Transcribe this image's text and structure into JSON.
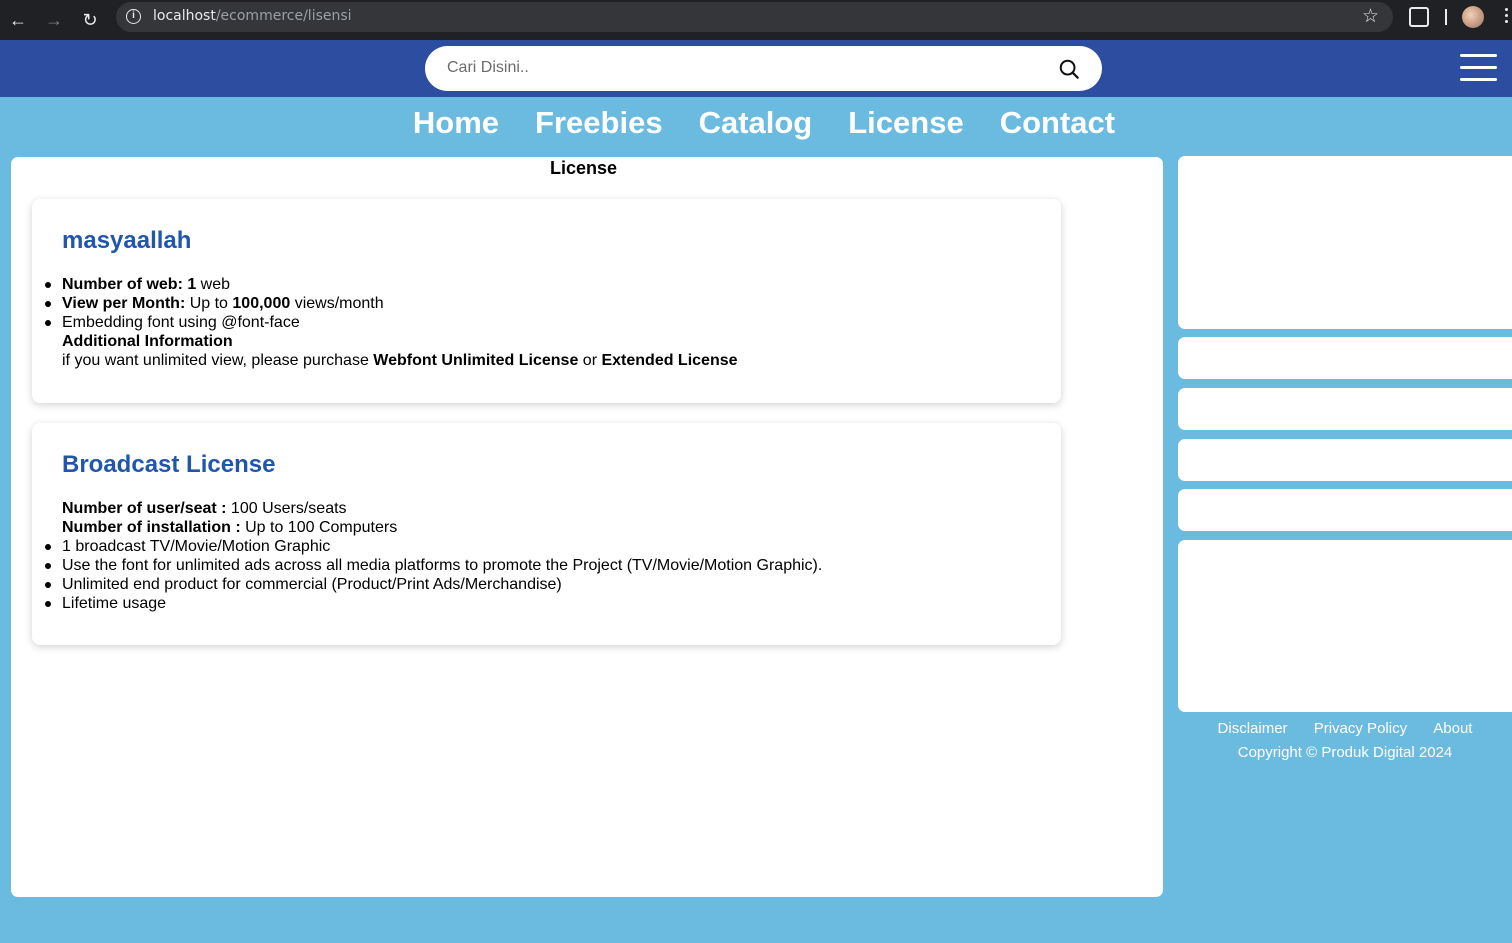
{
  "browser": {
    "url_host": "localhost",
    "url_path": "/ecommerce/lisensi"
  },
  "header": {
    "search_placeholder": "Cari Disini.."
  },
  "nav": {
    "items": [
      "Home",
      "Freebies",
      "Catalog",
      "License",
      "Contact"
    ]
  },
  "main": {
    "title": "License",
    "cards": [
      {
        "heading": "masyaallah",
        "items": [
          {
            "bold": "Number of web: 1",
            "text": " web"
          },
          {
            "bold": "View per Month:",
            "text": " Up to ",
            "bold2": "100,000",
            "text2": " views/month"
          },
          {
            "text": "Embedding font using @font-face"
          }
        ],
        "extra_title": "Additional Information",
        "extra_text": "if you want unlimited view, please purchase ",
        "extra_bold1": "Webfont Unlimited License",
        "extra_or": " or ",
        "extra_bold2": "Extended License"
      },
      {
        "heading": "Broadcast License",
        "lines": [
          {
            "bold": "Number of user/seat :",
            "text": " 100 Users/seats"
          },
          {
            "bold": "Number of installation :",
            "text": " Up to 100 Computers"
          }
        ],
        "items": [
          "1 broadcast TV/Movie/Motion Graphic",
          "Use the font for unlimited ads across all media platforms to promote the Project (TV/Movie/Motion Graphic).",
          "Unlimited end product for commercial (Product/Print Ads/Merchandise)",
          "Lifetime usage"
        ]
      }
    ]
  },
  "footer": {
    "links": [
      "Disclaimer",
      "Privacy Policy",
      "About"
    ],
    "copyright": "Copyright © Produk Digital 2024"
  },
  "colors": {
    "header_bg": "#2d4ea0",
    "page_bg": "#6bbbe0",
    "heading_blue": "#2156aa"
  }
}
